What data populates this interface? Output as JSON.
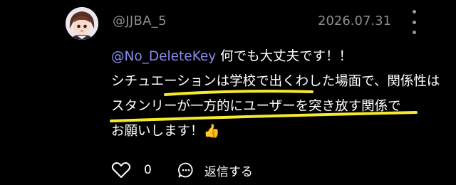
{
  "comment": {
    "username": "@JJBA_5",
    "timestamp": "2026.07.31",
    "mention": "@No_DeleteKey",
    "line1_rest": " 何でも大丈夫です！！",
    "line2": "シチュエーションは学校で出くわした場面で、関係性は",
    "line3": "スタンリーが一方的にユーザーを突き放す関係で",
    "line4": "お願いします！",
    "emoji": "👍",
    "icons": {
      "avatar": "anime-character-avatar",
      "more": "vertical-dots-icon",
      "like": "heart-outline-icon",
      "reply": "speech-bubble-icon"
    },
    "highlight_color": "#f6ea2c",
    "mention_color": "#8a8cf2"
  },
  "actions": {
    "like_count": "0",
    "reply_label": "返信する"
  }
}
